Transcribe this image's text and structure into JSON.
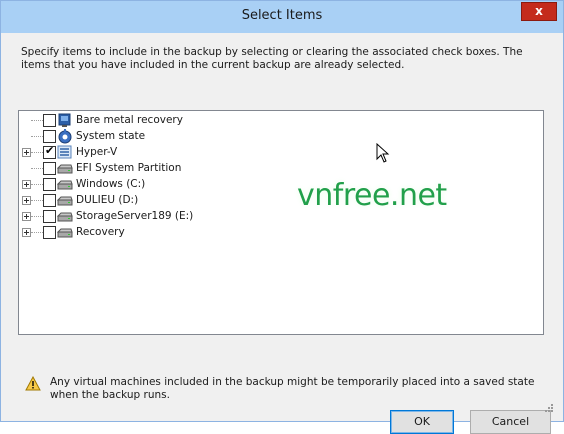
{
  "window": {
    "title": "Select Items",
    "close_glyph": "x"
  },
  "description": "Specify items to include in the backup by selecting or clearing the associated check boxes. The items that you have included in the current backup are already selected.",
  "tree": {
    "items": [
      {
        "label": "Bare metal recovery",
        "checked": false,
        "expandable": false,
        "icon": "bare-metal-icon"
      },
      {
        "label": "System state",
        "checked": false,
        "expandable": false,
        "icon": "system-state-icon"
      },
      {
        "label": "Hyper-V",
        "checked": true,
        "expandable": true,
        "icon": "hyperv-icon"
      },
      {
        "label": "EFI System Partition",
        "checked": false,
        "expandable": false,
        "icon": "drive-icon"
      },
      {
        "label": "Windows (C:)",
        "checked": false,
        "expandable": true,
        "icon": "drive-icon"
      },
      {
        "label": "DULIEU (D:)",
        "checked": false,
        "expandable": true,
        "icon": "drive-icon"
      },
      {
        "label": "StorageServer189 (E:)",
        "checked": false,
        "expandable": true,
        "icon": "drive-icon"
      },
      {
        "label": "Recovery",
        "checked": false,
        "expandable": true,
        "icon": "drive-icon"
      }
    ]
  },
  "watermark": "vnfree.net",
  "warning": "Any virtual machines included in the backup might be temporarily placed into a saved state when the backup runs.",
  "buttons": {
    "ok": "OK",
    "cancel": "Cancel"
  },
  "colors": {
    "titlebar": "#a9d0f5",
    "close": "#c42b1c",
    "watermark": "#22a04b"
  }
}
